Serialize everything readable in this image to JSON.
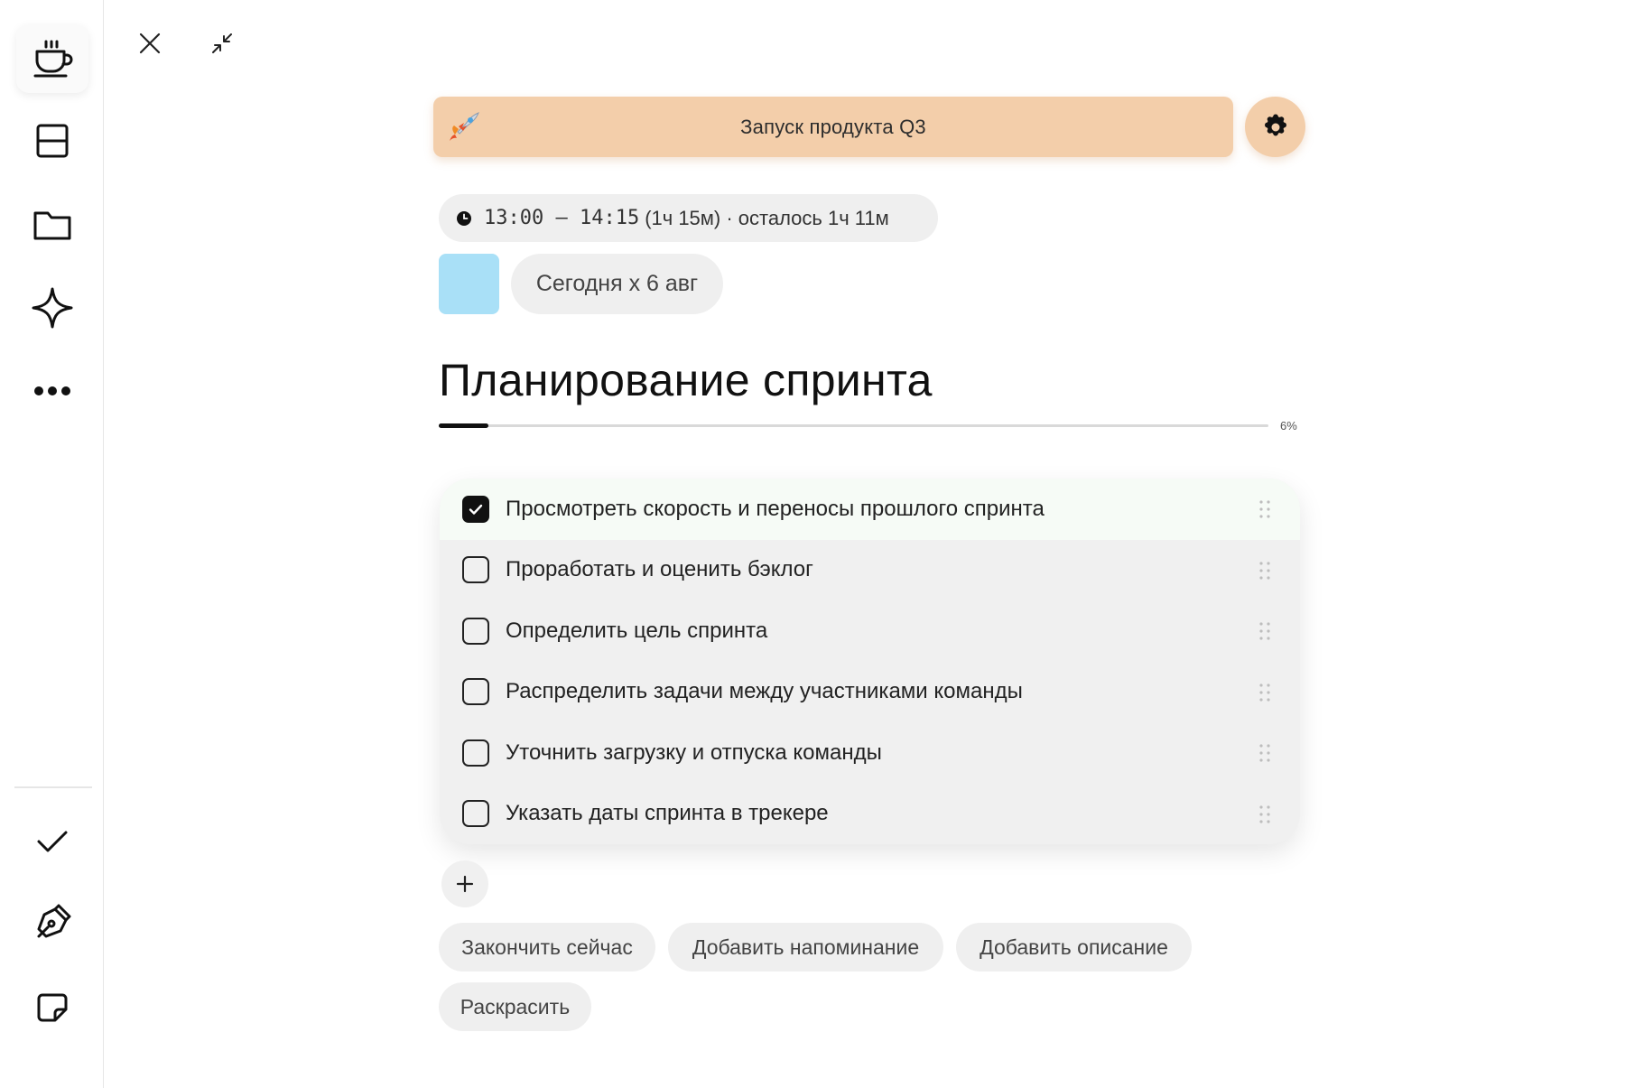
{
  "sidebar": {
    "top_items": [
      {
        "icon": "coffee-cup-icon",
        "active": true
      },
      {
        "icon": "split-layout-icon",
        "active": false
      },
      {
        "icon": "folder-icon",
        "active": false
      },
      {
        "icon": "sparkle-icon",
        "active": false
      },
      {
        "icon": "more-dots-icon",
        "active": false
      }
    ],
    "bottom_items": [
      {
        "icon": "checkmark-icon"
      },
      {
        "icon": "pen-nib-icon"
      },
      {
        "icon": "sticky-note-icon"
      }
    ]
  },
  "window": {
    "close_icon": "close-icon",
    "minimize_icon": "collapse-icon"
  },
  "event": {
    "title": "Запуск продукта Q3",
    "icon": "rocket-icon",
    "banner_color": "#f3ceaa"
  },
  "time": {
    "range": "13:00 — 14:15",
    "remaining": "(1ч 15м) · осталось 1ч 11м"
  },
  "date": {
    "swatch_color": "#a9e0f7",
    "label": "Сегодня x 6 авг"
  },
  "task": {
    "title": "Планирование спринта",
    "progress_percent": 6,
    "progress_label": "6%"
  },
  "checklist": [
    {
      "label": "Просмотреть скорость и переносы прошлого спринта",
      "checked": true
    },
    {
      "label": "Проработать и оценить бэклог",
      "checked": false
    },
    {
      "label": "Определить цель спринта",
      "checked": false
    },
    {
      "label": "Распределить задачи между участниками команды",
      "checked": false
    },
    {
      "label": "Уточнить загрузку и отпуска команды",
      "checked": false
    },
    {
      "label": "Указать даты спринта в трекере",
      "checked": false
    }
  ],
  "actions": {
    "finish_now": "Закончить сейчас",
    "add_reminder": "Добавить напоминание",
    "add_description": "Добавить описание",
    "colorize": "Раскрасить"
  }
}
